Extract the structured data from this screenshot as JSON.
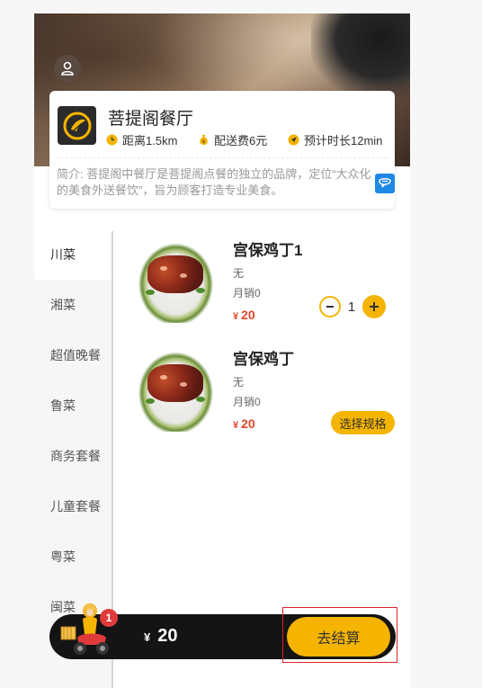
{
  "shop": {
    "name": "菩提阁餐厅",
    "distance": "距离1.5km",
    "delivery_fee": "配送费6元",
    "eta": "预计时长12min",
    "intro": "简介: 菩提阁中餐厅是菩提阁点餐的独立的品牌，定位“大众化的美食外送餐饮”，旨为顾客打造专业美食。"
  },
  "categories": [
    "川菜",
    "湘菜",
    "超值晚餐",
    "鲁菜",
    "商务套餐",
    "儿童套餐",
    "粤菜",
    "闽菜"
  ],
  "active_category": "川菜",
  "items": [
    {
      "name": "宫保鸡丁1",
      "desc": "无",
      "sales": "月销0",
      "currency": "¥",
      "price": "20",
      "quantity": "1"
    },
    {
      "name": "宫保鸡丁",
      "desc": "无",
      "sales": "月销0",
      "currency": "¥",
      "price": "20",
      "spec_label": "选择规格"
    }
  ],
  "cart": {
    "badge_count": "1",
    "currency": "¥",
    "total": "20",
    "checkout_label": "去结算"
  },
  "colors": {
    "accent": "#f5b400",
    "price": "#e0472a",
    "cart_bar": "#141414",
    "badge": "#e03a3a",
    "highlight_box": "#d8242b"
  },
  "icons": {
    "avatar": "user-icon",
    "distance": "clock-icon",
    "fee": "money-bag-icon",
    "eta": "navigation-arrow-icon",
    "intro_badge": "info-chat-icon",
    "cart": "delivery-rider-icon"
  }
}
